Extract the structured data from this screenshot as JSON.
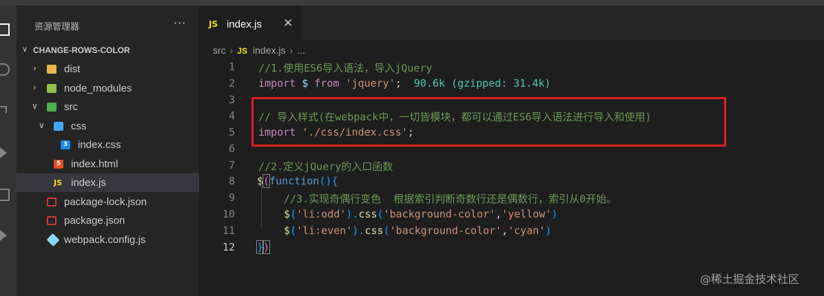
{
  "sidebar": {
    "header": "资源管理器",
    "more": "···",
    "project": "CHANGE-ROWS-COLOR",
    "tree": [
      {
        "name": "dist",
        "kind": "folder",
        "icon": "folder-dist-icon"
      },
      {
        "name": "node_modules",
        "kind": "folder",
        "icon": "folder-node-icon"
      },
      {
        "name": "src",
        "kind": "folder-open",
        "icon": "folder-src-icon"
      },
      {
        "name": "css",
        "kind": "folder-open",
        "icon": "folder-css-icon"
      },
      {
        "name": "index.css",
        "kind": "file",
        "icon": "css-file-icon",
        "badge": "3"
      },
      {
        "name": "index.html",
        "kind": "file",
        "icon": "html-file-icon",
        "badge": "5"
      },
      {
        "name": "index.js",
        "kind": "file",
        "icon": "js-file-icon",
        "badge": "JS"
      },
      {
        "name": "package-lock.json",
        "kind": "file",
        "icon": "npm-file-icon"
      },
      {
        "name": "package.json",
        "kind": "file",
        "icon": "npm-file-icon"
      },
      {
        "name": "webpack.config.js",
        "kind": "file",
        "icon": "webpack-file-icon"
      }
    ]
  },
  "editor": {
    "tab": {
      "badge": "JS",
      "title": "index.js",
      "close": "✕"
    },
    "breadcrumb": {
      "folder": "src",
      "badge": "JS",
      "file": "index.js",
      "rest": "..."
    },
    "line_numbers": [
      "1",
      "2",
      "3",
      "4",
      "5",
      "6",
      "7",
      "8",
      "9",
      "10",
      "11",
      "12"
    ],
    "lines": {
      "l1_comment": "//1.使用ES6导入语法，导入jQuery",
      "l2_import": "import",
      "l2_var": "$",
      "l2_from": "from",
      "l2_str": "'jquery'",
      "l2_semi": ";",
      "l2_hint": "90.6k (gzipped: 31.4k)",
      "l4_comment": "// 导入样式(在webpack中，一切皆模块，都可以通过ES6导入语法进行导入和使用)",
      "l5_import": "import",
      "l5_str": "'./css/index.css'",
      "l5_semi": ";",
      "l7_comment": "//2.定义jQuery的入口函数",
      "l8_dollar": "$",
      "l8_open": "(",
      "l8_function": "function",
      "l8_rest": "(){",
      "l9_comment": "//3.实现奇偶行变色  根据索引判断奇数行还是偶数行，索引从0开始。",
      "l10_dollar": "$",
      "l10_p1": "(",
      "l10_sel": "'li:odd'",
      "l10_p2": ").",
      "l10_css": "css",
      "l10_p3": "(",
      "l10_prop": "'background-color'",
      "l10_comma": ",",
      "l10_val": "'yellow'",
      "l10_p4": ")",
      "l11_dollar": "$",
      "l11_p1": "(",
      "l11_sel": "'li:even'",
      "l11_p2": ").",
      "l11_css": "css",
      "l11_p3": "(",
      "l11_prop": "'background-color'",
      "l11_comma": ",",
      "l11_val": "'cyan'",
      "l11_p4": ")",
      "l12_close1": "}",
      "l12_close2": ")"
    }
  },
  "watermark": "@稀土掘金技术社区",
  "colors": {
    "highlight_box": "#e0201f",
    "accent_js": "#f5de19"
  }
}
